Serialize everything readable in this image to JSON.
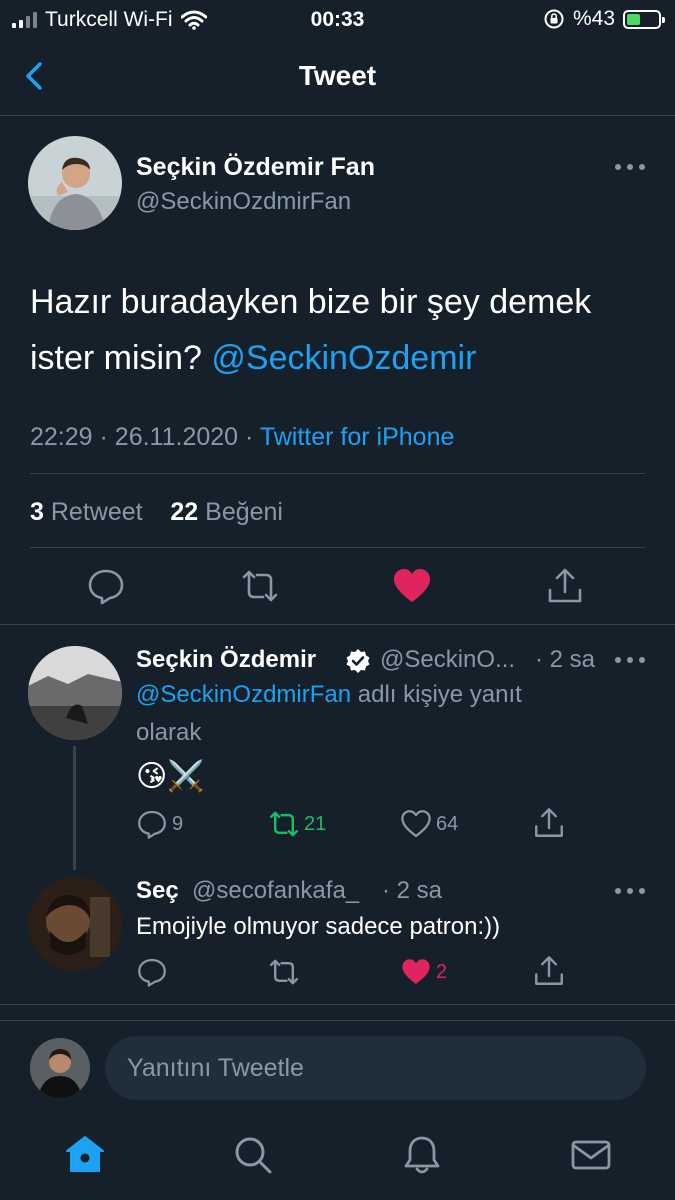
{
  "status_bar": {
    "carrier": "Turkcell Wi-Fi",
    "time": "00:33",
    "battery": "%43"
  },
  "header": {
    "title": "Tweet"
  },
  "tweet": {
    "author_name": "Seçkin Özdemir Fan",
    "author_handle": "@SeckinOzdmirFan",
    "text": "Hazır buradayken bize bir şey demek ister misin?",
    "mention": "@SeckinOzdemir",
    "time": "22:29",
    "date": "26.11.2020",
    "source": "Twitter for iPhone",
    "retweet_count": "3",
    "retweet_label": "Retweet",
    "like_count": "22",
    "like_label": "Beğeni",
    "liked": true
  },
  "replies": [
    {
      "name": "Seçkin Özdemir",
      "verified": true,
      "handle": "@SeckinO...",
      "time": "· 2 sa",
      "reply_to": "@SeckinOzdmirFan",
      "reply_to_suffix": " adlı kişiye yanıt",
      "reply_to_line2": "olarak",
      "text": "😘⚔️",
      "reply_count": "9",
      "retweet_count": "21",
      "retweeted": true,
      "like_count": "64"
    },
    {
      "name": "Seç",
      "handle": "@secofankafa_",
      "time": "· 2 sa",
      "text": "Emojiyle olmuyor sadece patron:))",
      "like_count": "2",
      "liked": true
    }
  ],
  "compose": {
    "placeholder": "Yanıtını Tweetle"
  },
  "colors": {
    "background": "#15202b",
    "accent": "#1da1f2",
    "like": "#e0245e",
    "retweet": "#17bf63",
    "muted": "#8899a6",
    "divider": "#38444d"
  },
  "icons": [
    "back-chevron-icon",
    "more-icon",
    "reply-icon",
    "retweet-icon",
    "heart-icon",
    "share-icon",
    "verified-icon",
    "home-icon",
    "search-icon",
    "bell-icon",
    "mail-icon"
  ]
}
